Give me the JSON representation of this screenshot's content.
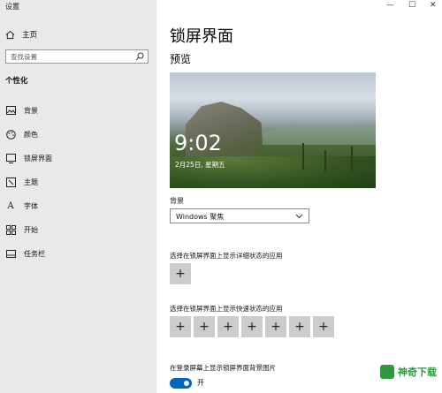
{
  "window": {
    "title": "设置",
    "controls": {
      "minimize": "—",
      "maximize": "☐",
      "close": "✕"
    }
  },
  "sidebar": {
    "home_label": "主页",
    "search_placeholder": "查找设置",
    "section_title": "个性化",
    "items": [
      {
        "label": "背景",
        "icon": "image-icon"
      },
      {
        "label": "颜色",
        "icon": "palette-icon"
      },
      {
        "label": "锁屏界面",
        "icon": "lock-screen-icon"
      },
      {
        "label": "主题",
        "icon": "brush-icon"
      },
      {
        "label": "字体",
        "icon": "font-icon"
      },
      {
        "label": "开始",
        "icon": "start-grid-icon"
      },
      {
        "label": "任务栏",
        "icon": "taskbar-icon"
      }
    ]
  },
  "main": {
    "title": "锁屏界面",
    "preview_label": "预览",
    "preview": {
      "time": "9:02",
      "date": "2月25日, 星期五"
    },
    "background_label": "背景",
    "background_value": "Windows 聚焦",
    "detailed_status_label": "选择在锁屏界面上显示详细状态的应用",
    "quick_status_label": "选择在锁屏界面上显示快速状态的应用",
    "quick_status_count": 7,
    "signin_label": "在登录屏幕上显示锁屏界面背景图片",
    "signin_toggle_state": "开",
    "signin_toggle_on": true
  },
  "watermark": {
    "text": "神奇下载"
  },
  "colors": {
    "accent": "#0067c0",
    "sidebar_bg": "#e9e9e9",
    "button_bg": "#cccccc"
  }
}
